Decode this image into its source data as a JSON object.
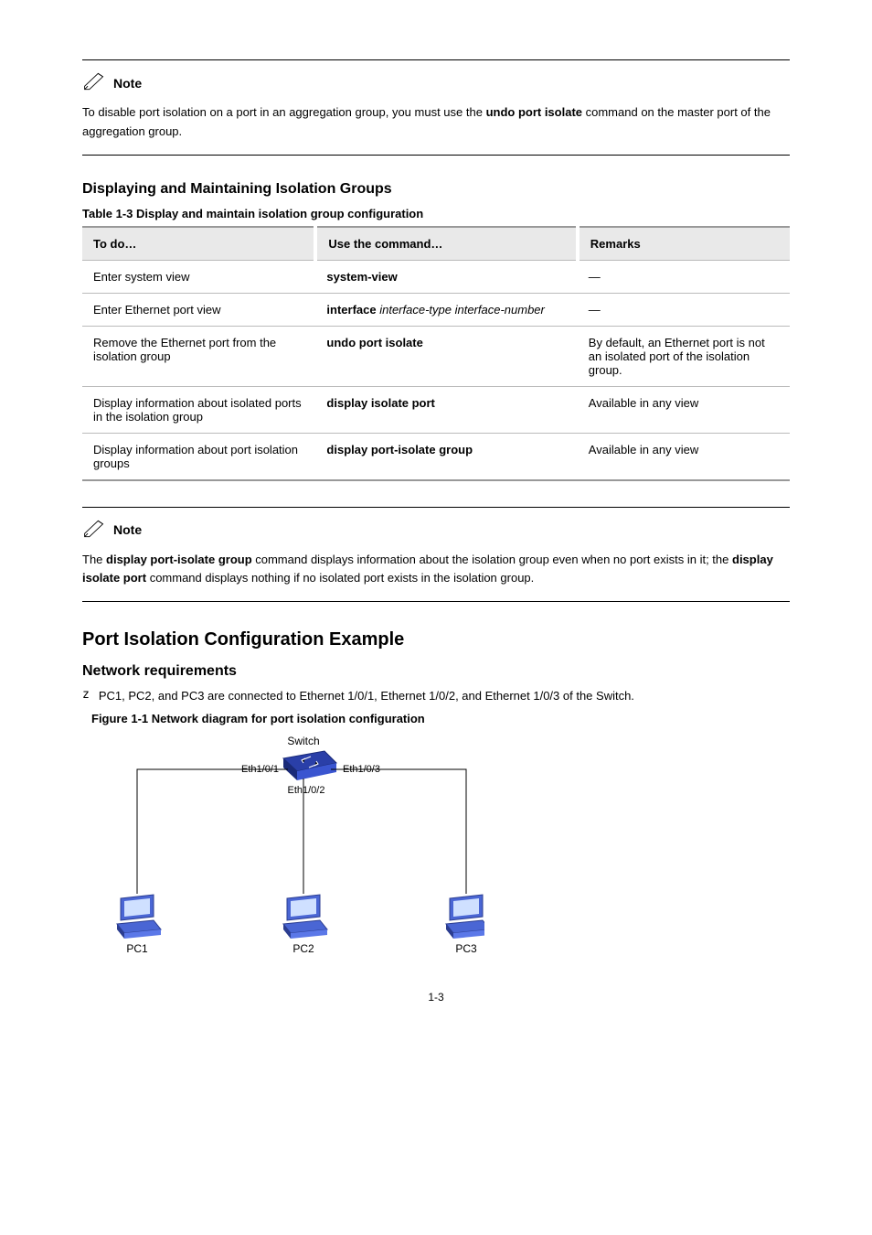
{
  "note1": {
    "label": "Note",
    "body_prefix": "To disable port isolation on a port in an aggregation group, you must use the ",
    "body_bold": "undo port isolate",
    "body_suffix": " command on the master port of the aggregation group."
  },
  "section_display": {
    "heading": "Displaying and Maintaining Isolation Groups",
    "table_caption": "Table 1-3 Display and maintain isolation group configuration",
    "table": {
      "headers": [
        "To do…",
        "Use the command…",
        "Remarks"
      ],
      "rows": [
        {
          "todo": "Enter system view",
          "cmd": "system-view",
          "arg": "",
          "rem": "—"
        },
        {
          "todo": "Enter Ethernet port view",
          "cmd": "interface ",
          "arg": "interface-type interface-number",
          "rem": "—"
        },
        {
          "todo": "Remove the Ethernet port from the isolation group",
          "cmd": "undo port isolate",
          "arg": "",
          "rem": "By default, an Ethernet port is not an isolated port of the isolation group."
        },
        {
          "todo": "Display information about isolated ports in the isolation group",
          "cmd": "display isolate port",
          "arg": "",
          "rem": "Available in any view"
        },
        {
          "todo": "Display information about port isolation groups",
          "cmd": "display port-isolate group",
          "arg": "",
          "rem": "Available in any view"
        }
      ]
    }
  },
  "note2": {
    "label": "Note",
    "body_prefix_1": "The ",
    "body_bold_1": "display port-isolate group",
    "body_mid_1": " command displays information about the isolation group even when no port exists in it; the ",
    "body_bold_2": "display isolate port",
    "body_suffix_1": " command displays nothing if no isolated port exists in the isolation group."
  },
  "example": {
    "heading": "Port Isolation Configuration Example",
    "subheading": "Network requirements",
    "bullet": "PC1, PC2, and PC3 are connected to Ethernet 1/0/1, Ethernet 1/0/2, and Ethernet 1/0/3 of the Switch.",
    "figure_caption": "Figure 1-1 Network diagram for port isolation configuration"
  },
  "diagram": {
    "switch_label": "Switch",
    "eth1": "Eth1/0/1",
    "eth2": "Eth1/0/2",
    "eth3": "Eth1/0/3",
    "pc1": "PC1",
    "pc2": "PC2",
    "pc3": "PC3"
  },
  "pagenum": "1-3"
}
